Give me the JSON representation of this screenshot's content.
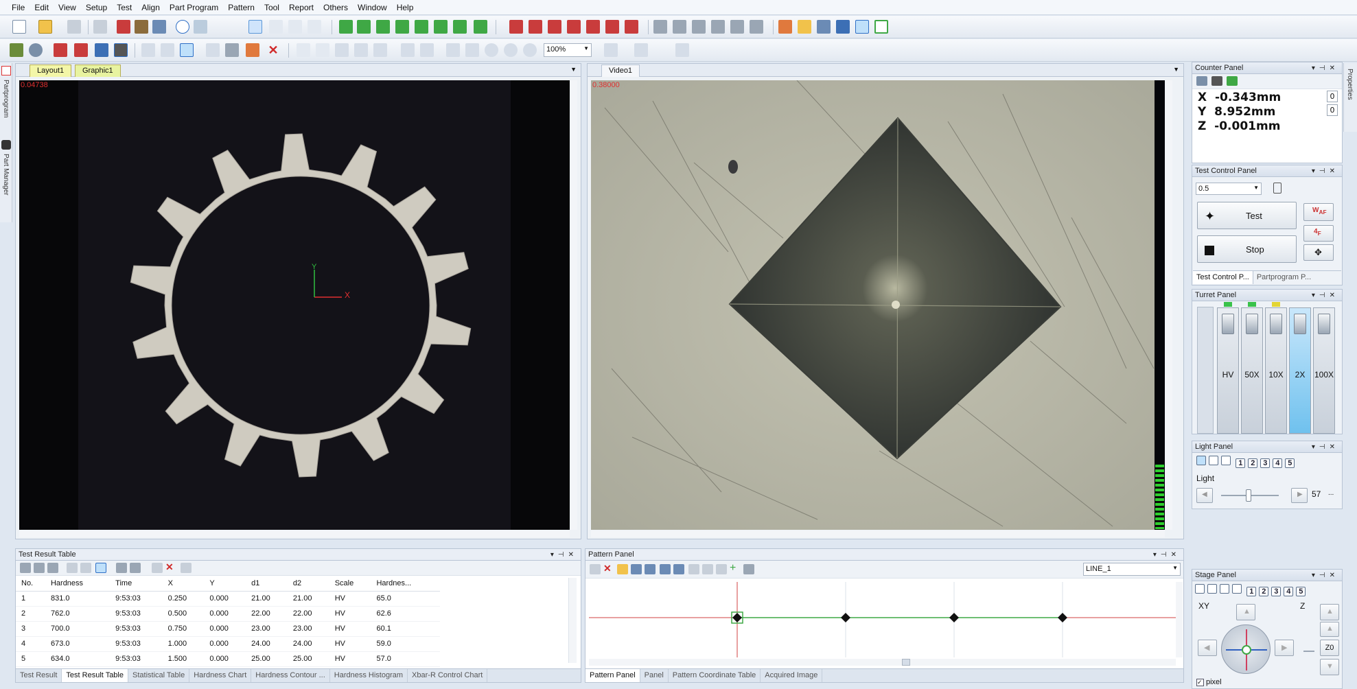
{
  "menu": [
    "File",
    "Edit",
    "View",
    "Setup",
    "Test",
    "Align",
    "Part Program",
    "Pattern",
    "Tool",
    "Report",
    "Others",
    "Window",
    "Help"
  ],
  "toolbar2": {
    "zoom": "100%"
  },
  "left_strip": {
    "tab1": "Partprogram",
    "tab2": "Part Manager"
  },
  "right_strip": {
    "tab": "Properties"
  },
  "graphic_view": {
    "tabs": [
      "Layout1",
      "Graphic1"
    ],
    "corner_value": "0.04738",
    "axis_x": "X",
    "axis_y": "Y"
  },
  "video_view": {
    "tab": "Video1",
    "corner_value": "0.38000"
  },
  "counter_panel": {
    "title": "Counter Panel",
    "rows": [
      {
        "axis": "X",
        "value": "-0.343mm",
        "reset": "0"
      },
      {
        "axis": "Y",
        "value": "8.952mm",
        "reset": "0"
      },
      {
        "axis": "Z",
        "value": "-0.001mm"
      }
    ]
  },
  "test_control": {
    "title": "Test Control Panel",
    "select_value": "0.5",
    "test_label": "Test",
    "stop_label": "Stop",
    "tabs": [
      "Test Control P...",
      "Partprogram P..."
    ]
  },
  "turret": {
    "title": "Turret Panel",
    "items": [
      "HV",
      "50X",
      "10X",
      "2X",
      "100X"
    ],
    "indicators": [
      "#39c24a",
      "#39c24a",
      "#e3d534"
    ]
  },
  "light": {
    "title": "Light Panel",
    "nums": [
      "1",
      "2",
      "3",
      "4",
      "5"
    ],
    "label": "Light",
    "value": "57",
    "level": 0.45,
    "more": "..."
  },
  "stage": {
    "title": "Stage Panel",
    "nums": [
      "1",
      "2",
      "3",
      "4",
      "5"
    ],
    "xy_label": "XY",
    "z_label": "Z",
    "z0_label": "Z0",
    "pixel_label": "pixel"
  },
  "result_table": {
    "title": "Test Result Table",
    "columns": [
      "No.",
      "Hardness",
      "Time",
      "X",
      "Y",
      "d1",
      "d2",
      "Scale",
      "Hardnes..."
    ],
    "rows": [
      [
        "1",
        "831.0",
        "9:53:03",
        "0.250",
        "0.000",
        "21.00",
        "21.00",
        "HV",
        "65.0"
      ],
      [
        "2",
        "762.0",
        "9:53:03",
        "0.500",
        "0.000",
        "22.00",
        "22.00",
        "HV",
        "62.6"
      ],
      [
        "3",
        "700.0",
        "9:53:03",
        "0.750",
        "0.000",
        "23.00",
        "23.00",
        "HV",
        "60.1"
      ],
      [
        "4",
        "673.0",
        "9:53:03",
        "1.000",
        "0.000",
        "24.00",
        "24.00",
        "HV",
        "59.0"
      ],
      [
        "5",
        "634.0",
        "9:53:03",
        "1.500",
        "0.000",
        "25.00",
        "25.00",
        "HV",
        "57.0"
      ]
    ],
    "bottom_tabs": [
      "Test Result",
      "Test Result Table",
      "Statistical Table",
      "Hardness Chart",
      "Hardness Contour ...",
      "Hardness Histogram",
      "Xbar-R Control Chart"
    ]
  },
  "pattern_panel": {
    "title": "Pattern Panel",
    "select_value": "LINE_1",
    "bottom_tabs": [
      "Pattern Panel",
      "Panel",
      "Pattern Coordinate Table",
      "Acquired Image"
    ]
  }
}
